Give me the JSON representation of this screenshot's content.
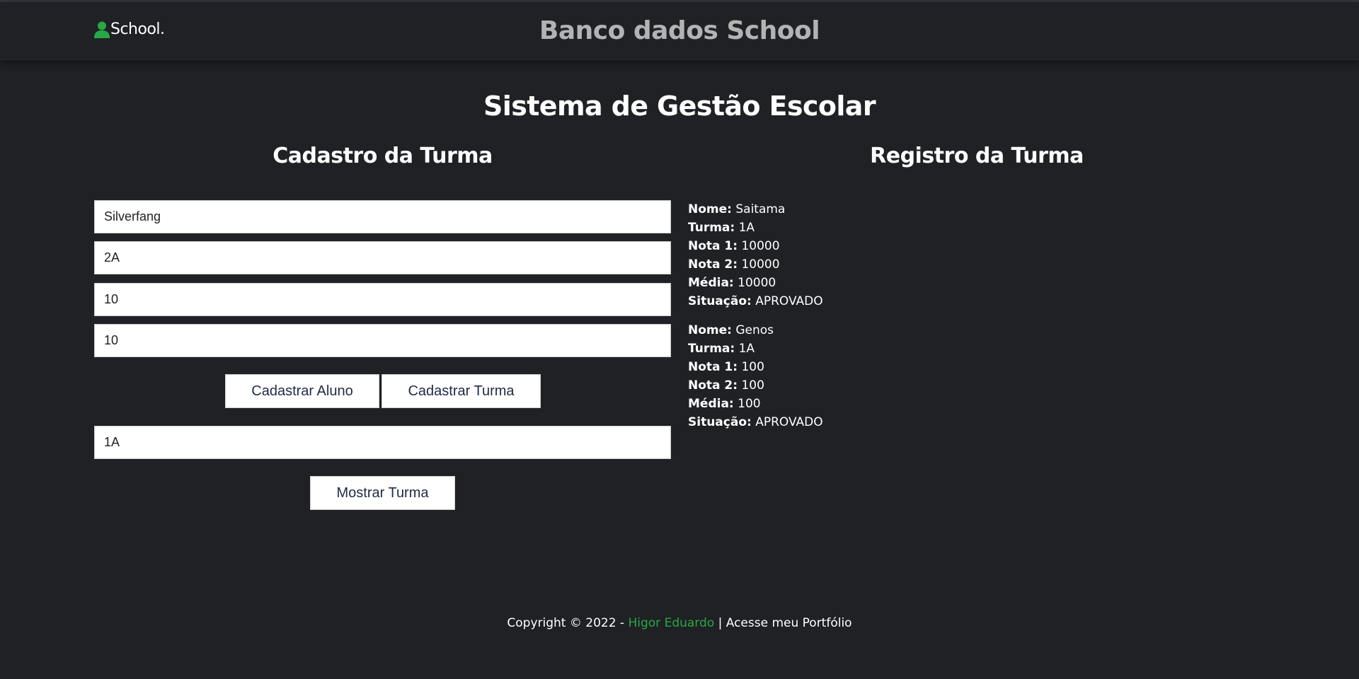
{
  "header": {
    "logo_text": "School.",
    "logo_icon": "user-icon",
    "site_title": "Banco dados School"
  },
  "main": {
    "title": "Sistema de Gestão Escolar",
    "form": {
      "title": "Cadastro da Turma",
      "name_value": "Silverfang",
      "class_value": "2A",
      "grade1_value": "10",
      "grade2_value": "10",
      "register_student_label": "Cadastrar Aluno",
      "register_class_label": "Cadastrar Turma",
      "search_class_value": "1A",
      "show_class_label": "Mostrar Turma"
    },
    "registry": {
      "title": "Registro da Turma",
      "labels": {
        "name": "Nome:",
        "class": "Turma:",
        "grade1": "Nota 1:",
        "grade2": "Nota 2:",
        "average": "Média:",
        "status": "Situação:"
      },
      "records": [
        {
          "name": "Saitama",
          "class": "1A",
          "grade1": "10000",
          "grade2": "10000",
          "average": "10000",
          "status": "APROVADO"
        },
        {
          "name": "Genos",
          "class": "1A",
          "grade1": "100",
          "grade2": "100",
          "average": "100",
          "status": "APROVADO"
        }
      ]
    }
  },
  "footer": {
    "prefix": "Copyright © 2022 - ",
    "author": "Higor Eduardo",
    "separator": " | ",
    "portfolio_link": "Acesse meu Portfólio"
  },
  "colors": {
    "background": "#202124",
    "accent_green": "#28a745",
    "site_title": "#b3b3b3"
  }
}
